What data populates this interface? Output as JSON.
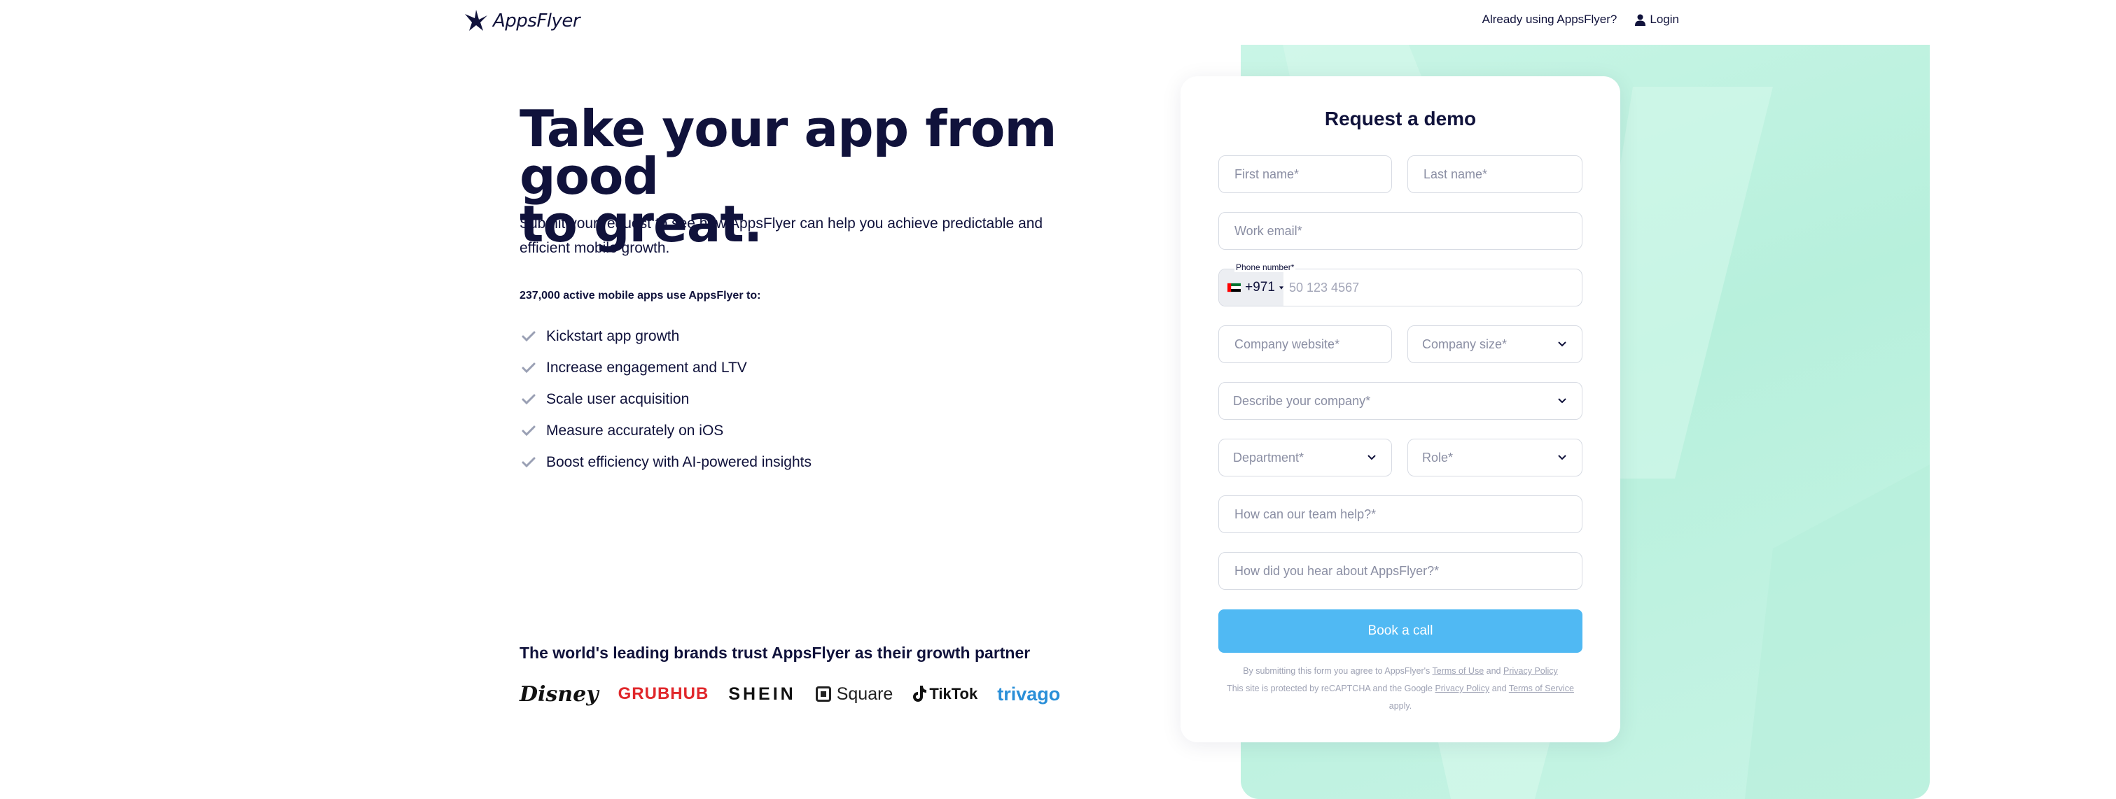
{
  "header": {
    "logo_text": "AppsFlyer",
    "already_using": "Already using AppsFlyer?",
    "login": "Login"
  },
  "hero": {
    "title_line1": "Take your app from good",
    "title_line2": "to great.",
    "subtitle": "Submit your request to see how AppsFlyer can help you achieve predictable and efficient mobile growth."
  },
  "stats": {
    "line": "237,000 active mobile apps use AppsFlyer to:"
  },
  "benefits": [
    "Kickstart app growth",
    "Increase engagement and LTV",
    "Scale user acquisition",
    "Measure accurately on iOS",
    "Boost efficiency with AI-powered insights"
  ],
  "brands": {
    "title": "The world's leading brands trust AppsFlyer as their growth partner",
    "logos": [
      "Disney",
      "GRUBHUB",
      "SHEIN",
      "Square",
      "TikTok",
      "trivago"
    ]
  },
  "form": {
    "title": "Request a demo",
    "first_name": "First name*",
    "last_name": "Last name*",
    "work_email": "Work email*",
    "phone_label": "Phone number*",
    "phone_code": "+971",
    "phone_placeholder": "50 123 4567",
    "company_website": "Company website*",
    "company_size": "Company size*",
    "describe_company": "Describe your company*",
    "department": "Department*",
    "role": "Role*",
    "team_help": "How can our team help?*",
    "hear_about": "How did you hear about AppsFlyer?*",
    "submit": "Book a call",
    "legal1_prefix": "By submitting this form you agree to AppsFlyer's",
    "terms_of_use": "Terms of Use",
    "and1": "and",
    "privacy_policy": "Privacy Policy",
    "legal2_prefix": "This site is protected by reCAPTCHA and the Google",
    "privacy_policy2": "Privacy Policy",
    "and2": "and",
    "terms_of_service": "Terms of Service",
    "apply": "apply."
  },
  "colors": {
    "navy": "#10123b",
    "button": "#50b9f3",
    "mint": "#c4f4e3"
  }
}
